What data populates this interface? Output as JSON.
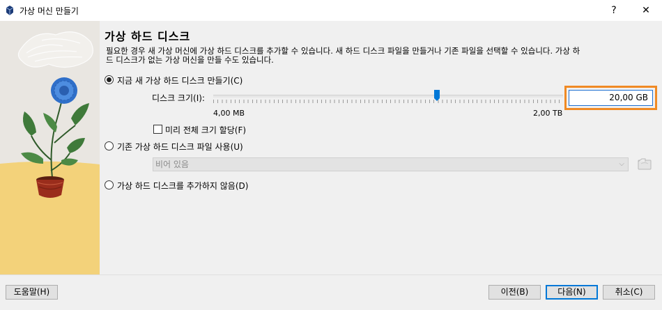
{
  "window": {
    "title": "가상 머신 만들기",
    "help_glyph": "?",
    "close_glyph": "✕"
  },
  "page": {
    "heading": "가상 하드 디스크",
    "description": "필요한 경우 새 가상 머신에 가상 하드 디스크를 추가할 수 있습니다. 새 하드 디스크 파일을 만들거나 기존 파일을 선택할 수 있습니다. 가상 하드 디스크가 없는 가상 머신을 만들 수도 있습니다."
  },
  "options": {
    "create_new": {
      "label": "지금 새 가상 하드 디스크 만들기(C)",
      "selected": true
    },
    "use_existing": {
      "label": "기존 가상 하드 디스크 파일 사용(U)",
      "selected": false
    },
    "no_disk": {
      "label": "가상 하드 디스크를 추가하지 않음(D)",
      "selected": false
    }
  },
  "disk_size": {
    "label": "디스크 크기(I):",
    "value": "20,00 GB",
    "min_label": "4,00 MB",
    "max_label": "2,00 TB",
    "slider_level": 0.63
  },
  "preallocate": {
    "label": "미리 전체 크기 할당(F)",
    "checked": false
  },
  "existing_file": {
    "placeholder_value": "비어 있음",
    "arrow": "⌵"
  },
  "buttons": {
    "help": "도움말(H)",
    "back": "이전(B)",
    "next": "다음(N)",
    "cancel": "취소(C)"
  },
  "colors": {
    "accent": "#0078d7",
    "highlight": "#f08a24",
    "wall": "#e9e6e1",
    "floor": "#f3d27a"
  }
}
